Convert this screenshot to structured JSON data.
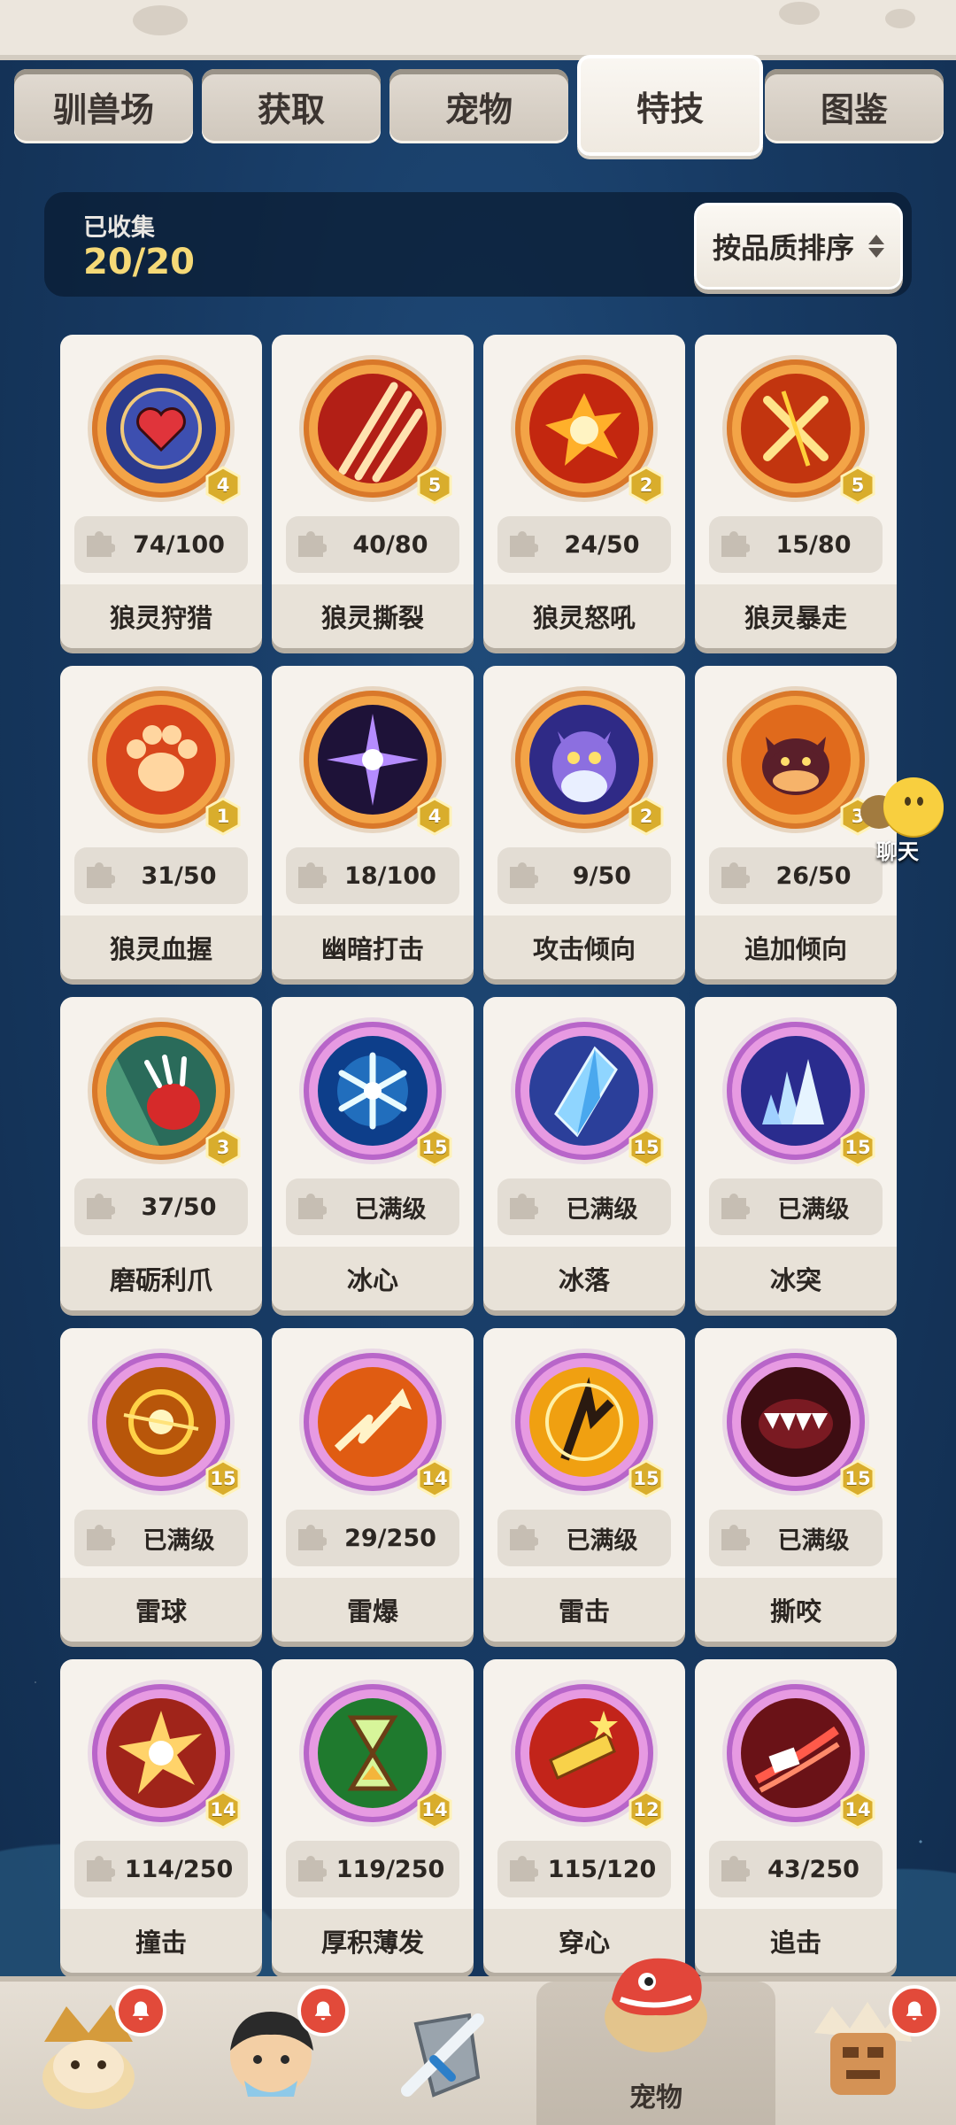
{
  "tabs": [
    {
      "label": "驯兽场",
      "active": false
    },
    {
      "label": "获取",
      "active": false
    },
    {
      "label": "宠物",
      "active": false
    },
    {
      "label": "特技",
      "active": true
    },
    {
      "label": "图鉴",
      "active": false
    }
  ],
  "collection": {
    "label": "已收集",
    "value": "20/20",
    "sort_label": "按品质排序"
  },
  "skills": [
    {
      "name": "狼灵狩猎",
      "level": "4",
      "progress": "74/100",
      "icon": "heart-target-icon",
      "ring": "orange"
    },
    {
      "name": "狼灵撕裂",
      "level": "5",
      "progress": "40/80",
      "icon": "claw-slash-icon",
      "ring": "orange"
    },
    {
      "name": "狼灵怒吼",
      "level": "2",
      "progress": "24/50",
      "icon": "explosion-icon",
      "ring": "orange"
    },
    {
      "name": "狼灵暴走",
      "level": "5",
      "progress": "15/80",
      "icon": "cross-slash-icon",
      "ring": "orange"
    },
    {
      "name": "狼灵血握",
      "level": "1",
      "progress": "31/50",
      "icon": "paw-icon",
      "ring": "orange"
    },
    {
      "name": "幽暗打击",
      "level": "4",
      "progress": "18/100",
      "icon": "dark-star-icon",
      "ring": "orange"
    },
    {
      "name": "攻击倾向",
      "level": "2",
      "progress": "9/50",
      "icon": "owl-icon",
      "ring": "orange"
    },
    {
      "name": "追加倾向",
      "level": "3",
      "progress": "26/50",
      "icon": "beast-face-icon",
      "ring": "orange"
    },
    {
      "name": "磨砺利爪",
      "level": "3",
      "progress": "37/50",
      "icon": "claw-glove-icon",
      "ring": "orange"
    },
    {
      "name": "冰心",
      "level": "15",
      "progress": "已满级",
      "icon": "snowflake-icon",
      "ring": "purple"
    },
    {
      "name": "冰落",
      "level": "15",
      "progress": "已满级",
      "icon": "ice-shard-icon",
      "ring": "purple"
    },
    {
      "name": "冰突",
      "level": "15",
      "progress": "已满级",
      "icon": "ice-crystal-icon",
      "ring": "purple"
    },
    {
      "name": "雷球",
      "level": "15",
      "progress": "已满级",
      "icon": "thunder-orb-icon",
      "ring": "purple"
    },
    {
      "name": "雷爆",
      "level": "14",
      "progress": "29/250",
      "icon": "lightning-arrow-icon",
      "ring": "purple"
    },
    {
      "name": "雷击",
      "level": "15",
      "progress": "已满级",
      "icon": "thunder-strike-icon",
      "ring": "purple"
    },
    {
      "name": "撕咬",
      "level": "15",
      "progress": "已满级",
      "icon": "fang-bite-icon",
      "ring": "purple"
    },
    {
      "name": "撞击",
      "level": "14",
      "progress": "114/250",
      "icon": "impact-burst-icon",
      "ring": "purple"
    },
    {
      "name": "厚积薄发",
      "level": "14",
      "progress": "119/250",
      "icon": "hourglass-icon",
      "ring": "purple"
    },
    {
      "name": "穿心",
      "level": "12",
      "progress": "115/120",
      "icon": "pierce-stars-icon",
      "ring": "purple"
    },
    {
      "name": "追击",
      "level": "14",
      "progress": "43/250",
      "icon": "chase-claw-icon",
      "ring": "purple"
    }
  ],
  "chat": {
    "label": "聊天"
  },
  "bottom_nav": [
    {
      "icon": "caveman-avatar-icon",
      "label": "",
      "badge": true
    },
    {
      "icon": "hero-avatar-icon",
      "label": "",
      "badge": true
    },
    {
      "icon": "sword-shield-icon",
      "label": "",
      "badge": false
    },
    {
      "icon": "pet-dino-icon",
      "label": "宠物",
      "badge": false,
      "active": true
    },
    {
      "icon": "totem-icon",
      "label": "",
      "badge": true
    }
  ],
  "colors": {
    "accent_gold": "#f5d977",
    "ring_orange": "#f3a447",
    "ring_purple": "#e79ae2",
    "badge_red": "#e24a3a"
  }
}
